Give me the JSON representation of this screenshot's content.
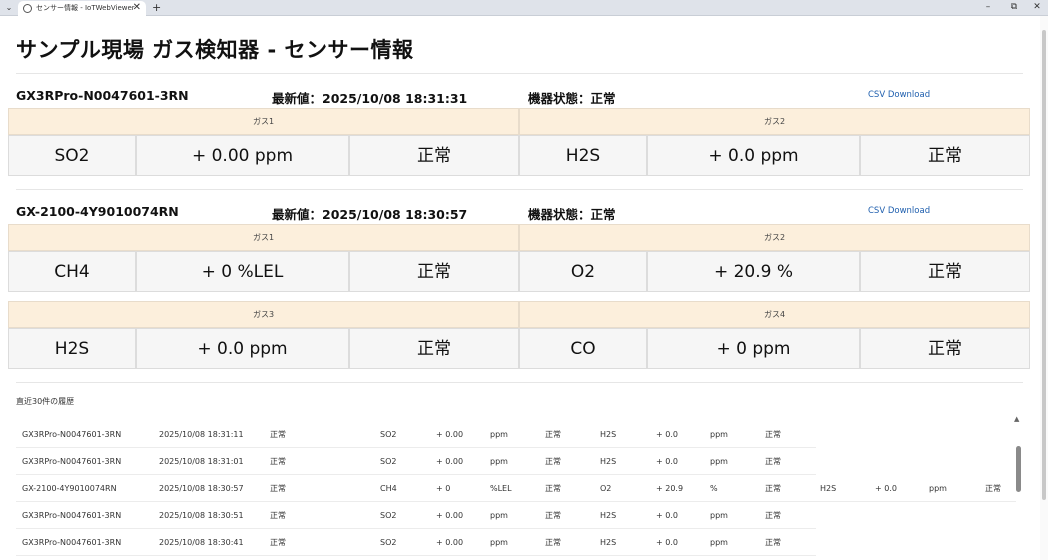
{
  "browser": {
    "tab_title": "センサー情報 - IoTWebViewer",
    "close_glyph": "✕",
    "new_tab_glyph": "+",
    "menu_glyph": "⌄",
    "minimize_glyph": "–",
    "restore_glyph": "⧉",
    "window_close_glyph": "✕"
  },
  "page": {
    "title": "サンプル現場 ガス検知器 - センサー情報"
  },
  "devices": [
    {
      "name": "GX3RPro-N0047601-3RN",
      "latest": "最新値：2025/10/08 18:31:31",
      "status": "機器状態：正常",
      "csv_label": "CSV Download",
      "rows": [
        {
          "gases": [
            {
              "header": "ガス1",
              "gas": "SO2",
              "value": "+ 0.00 ppm",
              "state": "正常"
            },
            {
              "header": "ガス2",
              "gas": "H2S",
              "value": "+ 0.0 ppm",
              "state": "正常"
            }
          ]
        }
      ]
    },
    {
      "name": "GX-2100-4Y9010074RN",
      "latest": "最新値：2025/10/08 18:30:57",
      "status": "機器状態：正常",
      "csv_label": "CSV Download",
      "rows": [
        {
          "gases": [
            {
              "header": "ガス1",
              "gas": "CH4",
              "value": "+ 0 %LEL",
              "state": "正常"
            },
            {
              "header": "ガス2",
              "gas": "O2",
              "value": "+ 20.9 %",
              "state": "正常"
            }
          ]
        },
        {
          "gases": [
            {
              "header": "ガス3",
              "gas": "H2S",
              "value": "+ 0.0 ppm",
              "state": "正常"
            },
            {
              "header": "ガス4",
              "gas": "CO",
              "value": "+ 0 ppm",
              "state": "正常"
            }
          ]
        }
      ]
    }
  ],
  "history": {
    "label": "直近30件の履歴",
    "rows": [
      [
        "GX3RPro-N0047601-3RN",
        "2025/10/08 18:31:11",
        "正常",
        "SO2",
        "+ 0.00",
        "ppm",
        "正常",
        "H2S",
        "+ 0.0",
        "ppm",
        "正常"
      ],
      [
        "GX3RPro-N0047601-3RN",
        "2025/10/08 18:31:01",
        "正常",
        "SO2",
        "+ 0.00",
        "ppm",
        "正常",
        "H2S",
        "+ 0.0",
        "ppm",
        "正常"
      ],
      [
        "GX-2100-4Y9010074RN",
        "2025/10/08 18:30:57",
        "正常",
        "CH4",
        "+ 0",
        "%LEL",
        "正常",
        "O2",
        "+ 20.9",
        "%",
        "正常",
        "H2S",
        "+ 0.0",
        "ppm",
        "正常"
      ],
      [
        "GX3RPro-N0047601-3RN",
        "2025/10/08 18:30:51",
        "正常",
        "SO2",
        "+ 0.00",
        "ppm",
        "正常",
        "H2S",
        "+ 0.0",
        "ppm",
        "正常"
      ],
      [
        "GX3RPro-N0047601-3RN",
        "2025/10/08 18:30:41",
        "正常",
        "SO2",
        "+ 0.00",
        "ppm",
        "正常",
        "H2S",
        "+ 0.0",
        "ppm",
        "正常"
      ]
    ]
  },
  "colors": {
    "header_bg": "#fcefdc",
    "cell_bg": "#f6f6f6",
    "link": "#1f5fae"
  }
}
